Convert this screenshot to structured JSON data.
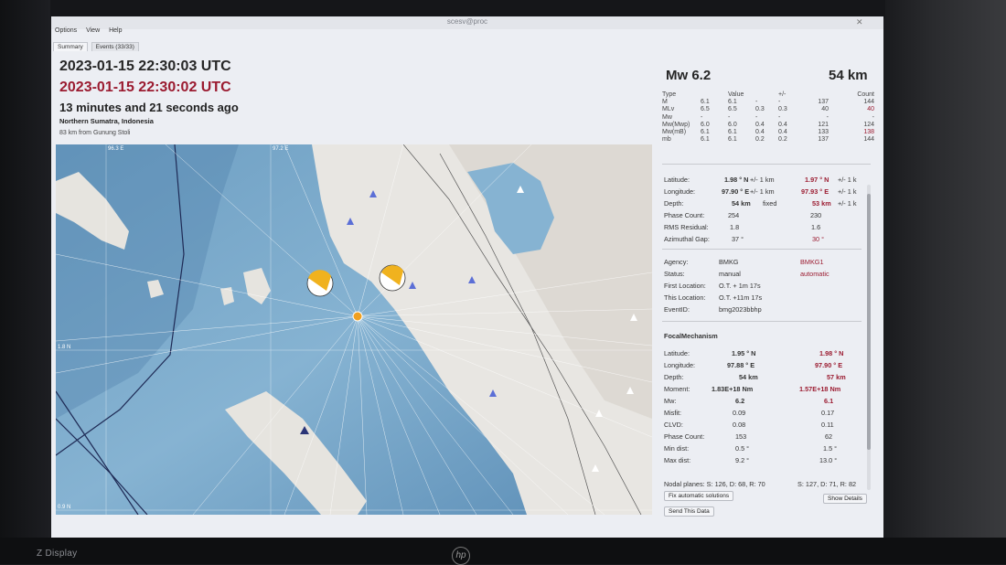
{
  "window": {
    "title": "scesv@proc"
  },
  "menu": [
    "Options",
    "View",
    "Help"
  ],
  "tabs": [
    "Summary",
    "Events (33/33)"
  ],
  "event": {
    "time_utc": "2023-01-15 22:30:03 UTC",
    "time_alt": "2023-01-15 22:30:02 UTC",
    "elapsed": "13 minutes and 21 seconds ago",
    "region": "Northern Sumatra, Indonesia",
    "nearest": "83 km from Gunung Stoli",
    "magnitude": "Mw 6.2",
    "depth": "54 km"
  },
  "colors": {
    "accent": "#9b1b30",
    "water": "#7aa8c6",
    "land": "#e8e6e2"
  },
  "map": {
    "grid_labels": [
      "96.3 E",
      "97.2 E",
      "1.8 N",
      "0.9 N"
    ]
  },
  "magnitudes": {
    "headers": [
      "Type",
      "Value",
      "+/-",
      "Count"
    ],
    "rows": [
      [
        "M",
        "6.1",
        "6.1",
        "-",
        "-",
        "137",
        "144"
      ],
      [
        "MLv",
        "6.5",
        "6.5",
        "0.3",
        "0.3",
        "40",
        "40"
      ],
      [
        "Mw",
        "-",
        "-",
        "-",
        "-",
        "-",
        "-"
      ],
      [
        "Mw(Mwp)",
        "6.0",
        "6.0",
        "0.4",
        "0.4",
        "121",
        "124"
      ],
      [
        "Mw(mB)",
        "6.1",
        "6.1",
        "0.4",
        "0.4",
        "133",
        "138"
      ],
      [
        "mb",
        "6.1",
        "6.1",
        "0.2",
        "0.2",
        "137",
        "144"
      ]
    ]
  },
  "origin": {
    "lat_label": "Latitude:",
    "lat": "1.98 ° N",
    "lat_unc": "+/-  1 km",
    "lat2": "1.97 ° N",
    "lat2_unc": "+/-  1 k",
    "lon_label": "Longitude:",
    "lon": "97.90 ° E",
    "lon_unc": "+/-  1 km",
    "lon2": "97.93 ° E",
    "lon2_unc": "+/-  1 k",
    "depth_label": "Depth:",
    "depth": "54 km",
    "depth_unc": "fixed",
    "depth2": "53 km",
    "depth2_unc": "+/-  1 k",
    "phase_label": "Phase Count:",
    "phase": "254",
    "phase2": "230",
    "rms_label": "RMS Residual:",
    "rms": "1.8",
    "rms2": "1.6",
    "gap_label": "Azimuthal Gap:",
    "gap": "37 °",
    "gap2": "30 °",
    "agency_label": "Agency:",
    "agency": "BMKG",
    "agency2": "BMKG1",
    "status_label": "Status:",
    "status": "manual",
    "status2": "automatic",
    "first_label": "First Location:",
    "first": "O.T. + 1m 17s",
    "this_label": "This Location:",
    "this": "O.T. +11m 17s",
    "eventid_label": "EventID:",
    "eventid": "bmg2023bbhp"
  },
  "focal": {
    "title": "FocalMechanism",
    "lat_label": "Latitude:",
    "lat": "1.95 ° N",
    "lat2": "1.98 ° N",
    "lon_label": "Longitude:",
    "lon": "97.88 ° E",
    "lon2": "97.90 ° E",
    "depth_label": "Depth:",
    "depth": "54 km",
    "depth2": "57 km",
    "moment_label": "Moment:",
    "moment": "1.83E+18 Nm",
    "moment2": "1.57E+18 Nm",
    "mw_label": "Mw:",
    "mw": "6.2",
    "mw2": "6.1",
    "misfit_label": "Misfit:",
    "misfit": "0.09",
    "misfit2": "0.17",
    "clvd_label": "CLVD:",
    "clvd": "0.08",
    "clvd2": "0.11",
    "phase_label": "Phase Count:",
    "phase": "153",
    "phase2": "62",
    "mind_label": "Min dist:",
    "mind": "0.5 °",
    "mind2": "1.5 °",
    "maxd_label": "Max dist:",
    "maxd": "9.2 °",
    "maxd2": "13.0 °",
    "nodal": "Nodal planes: S: 126, D: 68, R: 70",
    "nodal2": "S: 127, D: 71, R: 82"
  },
  "buttons": {
    "fix": "Fix automatic solutions",
    "send": "Send This Data",
    "details": "Show Details"
  },
  "monitor": {
    "brand": "Z Display",
    "logo": "hp"
  }
}
